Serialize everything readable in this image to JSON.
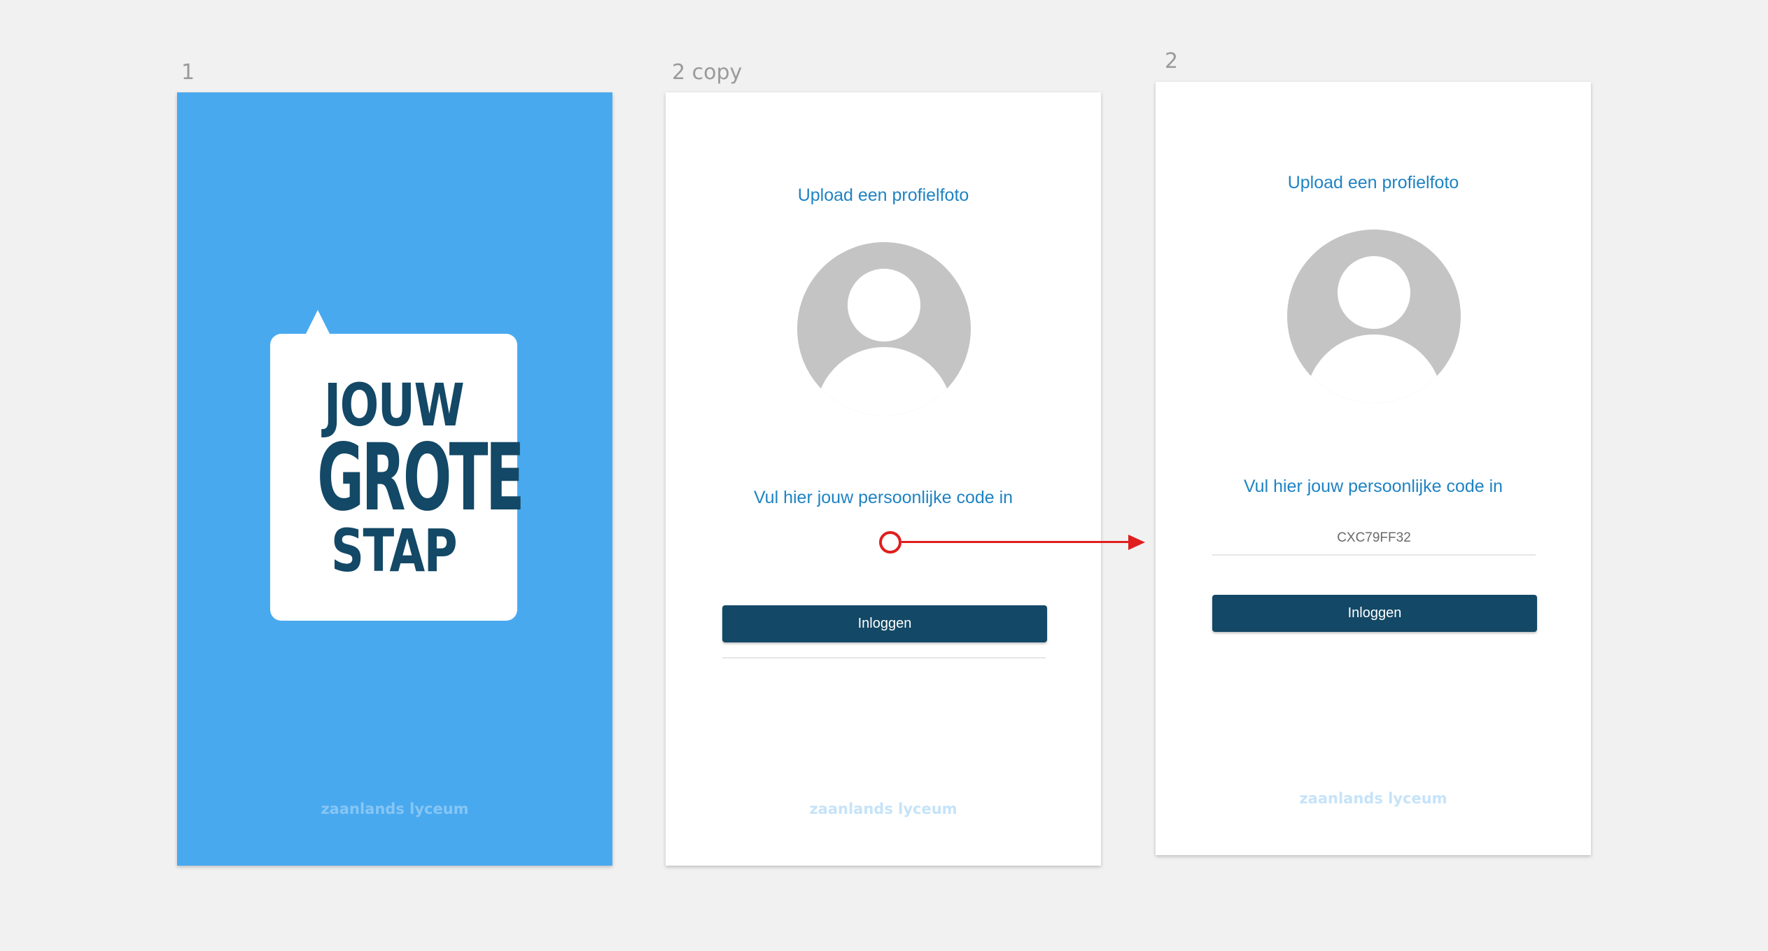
{
  "artboards": {
    "splash": {
      "label": "1",
      "logo_lines": [
        "JOUW",
        "GROTE",
        "STAP"
      ],
      "footer_brand": "zaanlands lyceum",
      "background": "#49a9ef"
    },
    "login_copy": {
      "label": "2 copy",
      "upload_title": "Upload een profielfoto",
      "code_label": "Vul hier jouw persoonlijke code in",
      "code_value": "",
      "login_button": "Inloggen",
      "footer_brand": "zaanlands lyceum"
    },
    "login": {
      "label": "2",
      "upload_title": "Upload een profielfoto",
      "code_label": "Vul hier jouw persoonlijke code in",
      "code_value": "CXC79FF32",
      "login_button": "Inloggen",
      "footer_brand": "zaanlands lyceum"
    }
  },
  "icons": {
    "avatar": "user-avatar-placeholder-icon",
    "hotspot": "prototype-hotspot-icon",
    "arrow": "prototype-link-arrow-icon"
  },
  "colors": {
    "canvas": "#f1f1f1",
    "brand_blue": "#49a9ef",
    "text_blue": "#1f83c3",
    "navy": "#134866",
    "link_red": "#e01e1e",
    "avatar_grey": "#c4c4c4"
  }
}
